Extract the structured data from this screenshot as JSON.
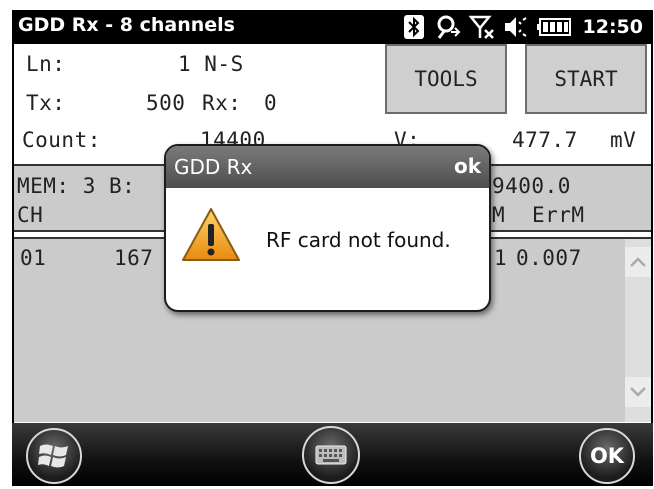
{
  "titlebar": {
    "title": "GDD Rx - 8 channels",
    "clock": "12:50",
    "icons": [
      "bluetooth-icon",
      "sync-icon",
      "no-signal-icon",
      "volume-muted-icon",
      "battery-icon"
    ]
  },
  "info": {
    "ln_label": "Ln:",
    "ln_value": "1 N-S",
    "tx_label": "Tx:",
    "tx_value": "500",
    "rx_label": "Rx:",
    "rx_value": "0",
    "count_label": "Count:",
    "count_value": "14400",
    "v_label": "V:",
    "v_value": "477.7",
    "v_unit": "mV"
  },
  "buttons": {
    "tools": "TOOLS",
    "start": "START"
  },
  "mem_panel": {
    "line1_left": "MEM: 3 B:",
    "line1_right": "9400.0",
    "col_ch": "CH",
    "col_m_partial": "M",
    "col_errm": "ErrM"
  },
  "list": {
    "rows": [
      {
        "ch": "01",
        "value": "167",
        "right_partial": "1",
        "errm": "0.007"
      }
    ]
  },
  "dialog": {
    "title": "GDD Rx",
    "ok": "ok",
    "message": "RF card not found."
  },
  "bottombar": {
    "ok_label": "OK"
  },
  "colors": {
    "titlebar_bg": "#000000",
    "panel_bg": "#cbcbcb",
    "warning_fill": "#f0a020"
  }
}
